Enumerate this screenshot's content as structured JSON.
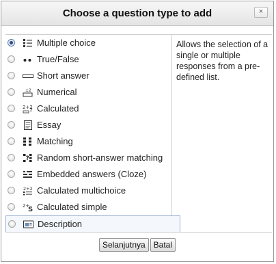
{
  "dialog": {
    "title": "Choose a question type to add",
    "close_label": "×"
  },
  "options": [
    {
      "label": "Multiple choice",
      "icon": "multiple-choice-icon",
      "checked": true
    },
    {
      "label": "True/False",
      "icon": "true-false-icon",
      "checked": false
    },
    {
      "label": "Short answer",
      "icon": "short-answer-icon",
      "checked": false
    },
    {
      "label": "Numerical",
      "icon": "numerical-icon",
      "checked": false
    },
    {
      "label": "Calculated",
      "icon": "calculated-icon",
      "checked": false
    },
    {
      "label": "Essay",
      "icon": "essay-icon",
      "checked": false
    },
    {
      "label": "Matching",
      "icon": "matching-icon",
      "checked": false
    },
    {
      "label": "Random short-answer matching",
      "icon": "random-short-answer-matching-icon",
      "checked": false
    },
    {
      "label": "Embedded answers (Cloze)",
      "icon": "embedded-answers-icon",
      "checked": false
    },
    {
      "label": "Calculated multichoice",
      "icon": "calculated-multichoice-icon",
      "checked": false
    },
    {
      "label": "Calculated simple",
      "icon": "calculated-simple-icon",
      "checked": false
    },
    {
      "label": "Description",
      "icon": "description-icon",
      "checked": false
    }
  ],
  "description": {
    "text": "Allows the selection of a single or multiple responses from a pre-defined list."
  },
  "buttons": {
    "next_label": "Selanjutnya",
    "cancel_label": "Batal"
  },
  "colors": {
    "selected_radio": "#2d4e84",
    "border": "#cfcfcf"
  }
}
